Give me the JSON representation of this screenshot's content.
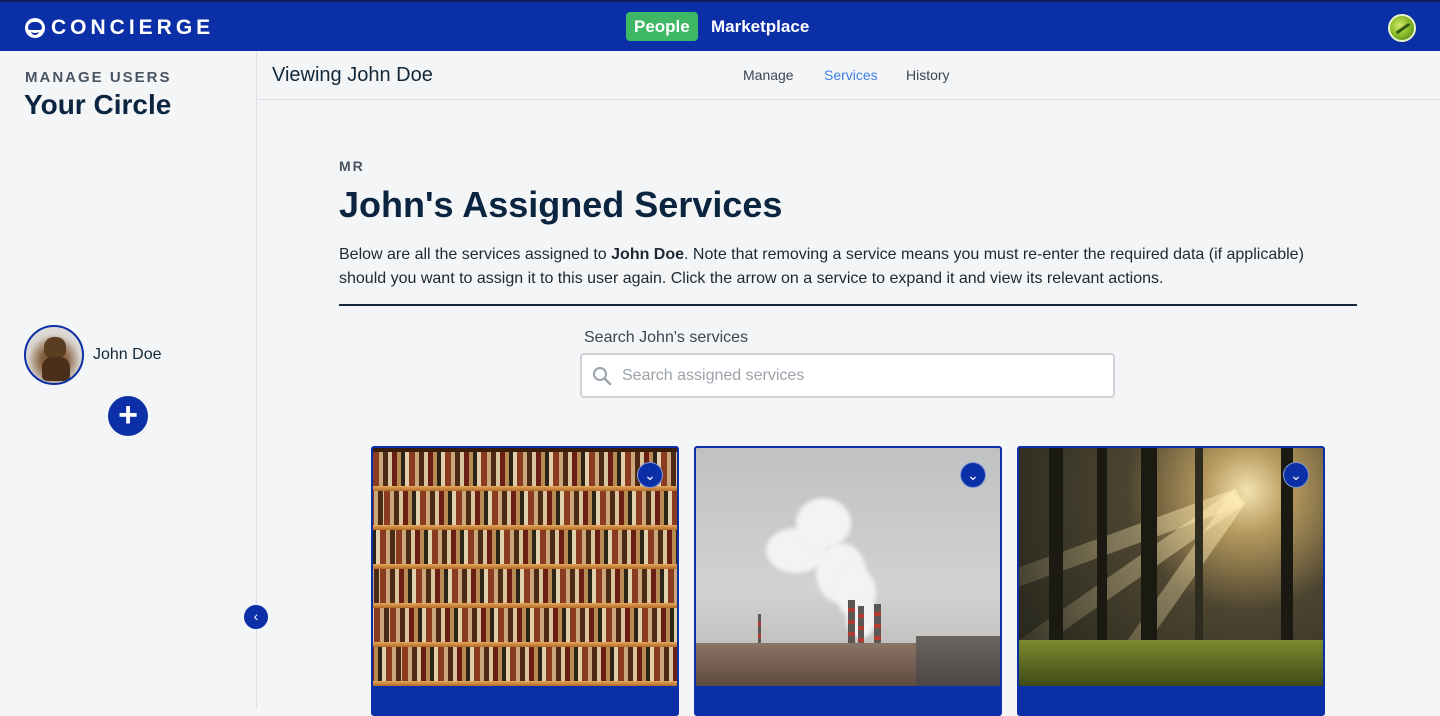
{
  "app": {
    "brand": "CONCIERGE",
    "nav": {
      "people": "People",
      "marketplace": "Marketplace"
    }
  },
  "sidebar": {
    "kicker": "MANAGE USERS",
    "title": "Your Circle",
    "members": [
      {
        "name": "John Doe"
      }
    ],
    "collapse_glyph": "‹",
    "add_glyph": "+"
  },
  "subheader": {
    "title": "Viewing John Doe",
    "tabs": [
      {
        "label": "Manage",
        "active": false
      },
      {
        "label": "Services",
        "active": true
      },
      {
        "label": "History",
        "active": false
      }
    ]
  },
  "main": {
    "kicker": "MR",
    "title": "John's Assigned Services",
    "description_pre": "Below are all the services assigned to ",
    "description_bold": "John Doe",
    "description_post": ". Note that removing a service means you must re-enter the required data (if applicable) should you want to assign it to this user again. Click the arrow on a service to expand it and view its relevant actions.",
    "search": {
      "label": "Search John's services",
      "placeholder": "Search assigned services",
      "value": ""
    },
    "services": [
      {
        "image": "bookshelf",
        "expand_icon": "chevron-down-icon"
      },
      {
        "image": "smokestacks",
        "expand_icon": "chevron-down-icon"
      },
      {
        "image": "forest-sunlight",
        "expand_icon": "chevron-down-icon"
      }
    ]
  },
  "colors": {
    "primary": "#0b2fa6",
    "people_badge": "#3fb866",
    "active_tab": "#3f7fe0",
    "heading": "#0b2540",
    "background": "#f4f5f6"
  }
}
